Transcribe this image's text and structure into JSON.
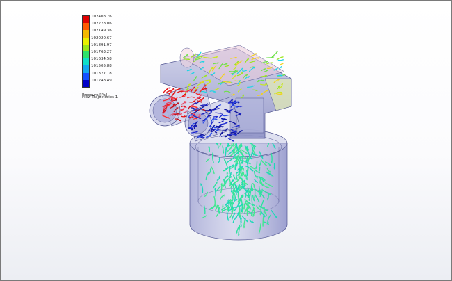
{
  "legend": {
    "title": "Pressure [Pa]",
    "subtitle": "Flow Trajectories 1",
    "values": [
      "102408.76",
      "102278.06",
      "102149.36",
      "102020.67",
      "101891.97",
      "101763.27",
      "101634.58",
      "101505.88",
      "101377.18",
      "101248.49"
    ],
    "colors": [
      "#e00000",
      "#ff5a00",
      "#f5b800",
      "#e9f000",
      "#9be61a",
      "#2fe36a",
      "#10e0c8",
      "#14a8f0",
      "#1450ff",
      "#0000c8"
    ]
  },
  "model": {
    "body_color": "#8b8fc6",
    "trajectory_colors": {
      "high": "#e41414",
      "low": "#1b27cf",
      "mid": "#f2d21c",
      "swirl": "#2fe2a0",
      "cyan": "#1fd4e4"
    }
  }
}
